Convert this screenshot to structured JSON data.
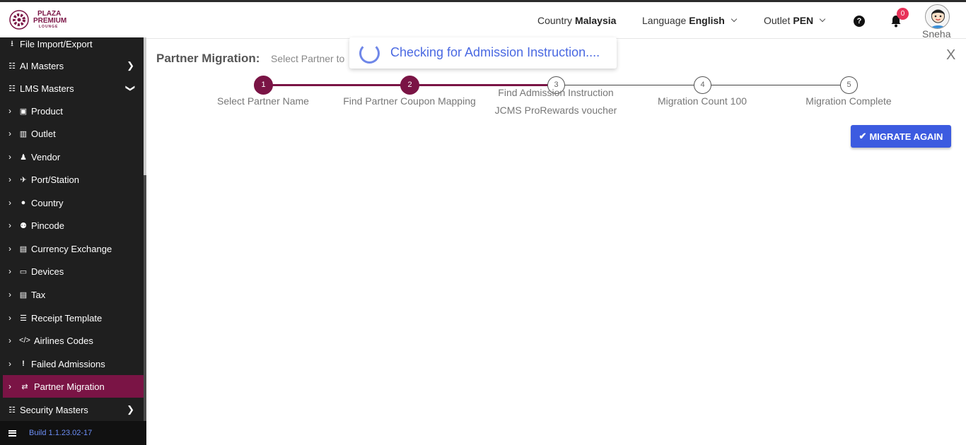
{
  "header": {
    "logo_line1": "PLAZA",
    "logo_line2": "PREMIUM",
    "logo_line3": "LOUNGE",
    "country_label": "Country",
    "country_value": "Malaysia",
    "language_label": "Language",
    "language_value": "English",
    "outlet_label": "Outlet",
    "outlet_value": "PEN",
    "help_glyph": "?",
    "notification_count": "0",
    "user_name": "Sneha"
  },
  "sidebar": {
    "items": [
      {
        "label": "File Import/Export",
        "icon": "upload-icon"
      },
      {
        "label": "AI Masters",
        "icon": "sitemap-icon"
      },
      {
        "label": "LMS Masters",
        "icon": "sitemap-icon"
      },
      {
        "label": "Product",
        "icon": "gift-icon"
      },
      {
        "label": "Outlet",
        "icon": "building-icon"
      },
      {
        "label": "Vendor",
        "icon": "person-icon"
      },
      {
        "label": "Port/Station",
        "icon": "plane-icon"
      },
      {
        "label": "Country",
        "icon": "globe-icon"
      },
      {
        "label": "Pincode",
        "icon": "map-marker-icon"
      },
      {
        "label": "Currency Exchange",
        "icon": "money-icon"
      },
      {
        "label": "Devices",
        "icon": "laptop-icon"
      },
      {
        "label": "Tax",
        "icon": "money-icon"
      },
      {
        "label": "Receipt Template",
        "icon": "list-icon"
      },
      {
        "label": "Airlines Codes",
        "icon": "code-icon"
      },
      {
        "label": "Failed Admissions",
        "icon": "exclamation-icon"
      },
      {
        "label": "Partner Migration",
        "icon": "exchange-icon"
      },
      {
        "label": "Security Masters",
        "icon": "sitemap-icon"
      }
    ],
    "build": "Build 1.1.23.02-17"
  },
  "main": {
    "title": "Partner Migration:",
    "subtitle": "Select Partner to",
    "close": "X",
    "toast": "Checking for Admission Instruction....",
    "steps": [
      {
        "num": "1",
        "label": "Select Partner Name",
        "label2": "",
        "state": "done"
      },
      {
        "num": "2",
        "label": "Find Partner Coupon Mapping",
        "label2": "",
        "state": "done"
      },
      {
        "num": "3",
        "label": "Find Admission Instruction",
        "label2": "JCMS ProRewards voucher",
        "state": "todo"
      },
      {
        "num": "4",
        "label": "Migration Count 100",
        "label2": "",
        "state": "todo"
      },
      {
        "num": "5",
        "label": "Migration Complete",
        "label2": "",
        "state": "todo"
      }
    ],
    "migrate_button": "MIGRATE AGAIN"
  },
  "colors": {
    "brand": "#7a1445",
    "accent": "#3c5be0",
    "sidebar_bg": "#1f1f1f",
    "badge": "#e8335a"
  }
}
